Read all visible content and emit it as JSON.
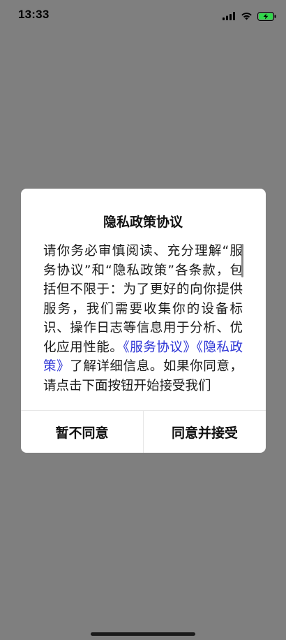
{
  "status_bar": {
    "time": "13:33",
    "icons": [
      "cellular-signal-icon",
      "wifi-icon",
      "battery-charging-icon"
    ],
    "battery_color": "#32d74b"
  },
  "dialog": {
    "title": "隐私政策协议",
    "body_prefix": "请你务必审慎阅读、充分理解“服务协议”和“隐私政策”各条款，包括但不限于：为了更好的向你提供服务，我们需要收集你的设备标识、操作日志等信息用于分析、优化应用性能。",
    "link_service": "《服务协议》",
    "link_privacy": "《隐私政策》",
    "body_suffix": "了解详细信息。如果你同意，请点击下面按钮开始接受我们",
    "link_color": "#2b33d6",
    "buttons": {
      "disagree": "暂不同意",
      "agree": "同意并接受"
    }
  }
}
